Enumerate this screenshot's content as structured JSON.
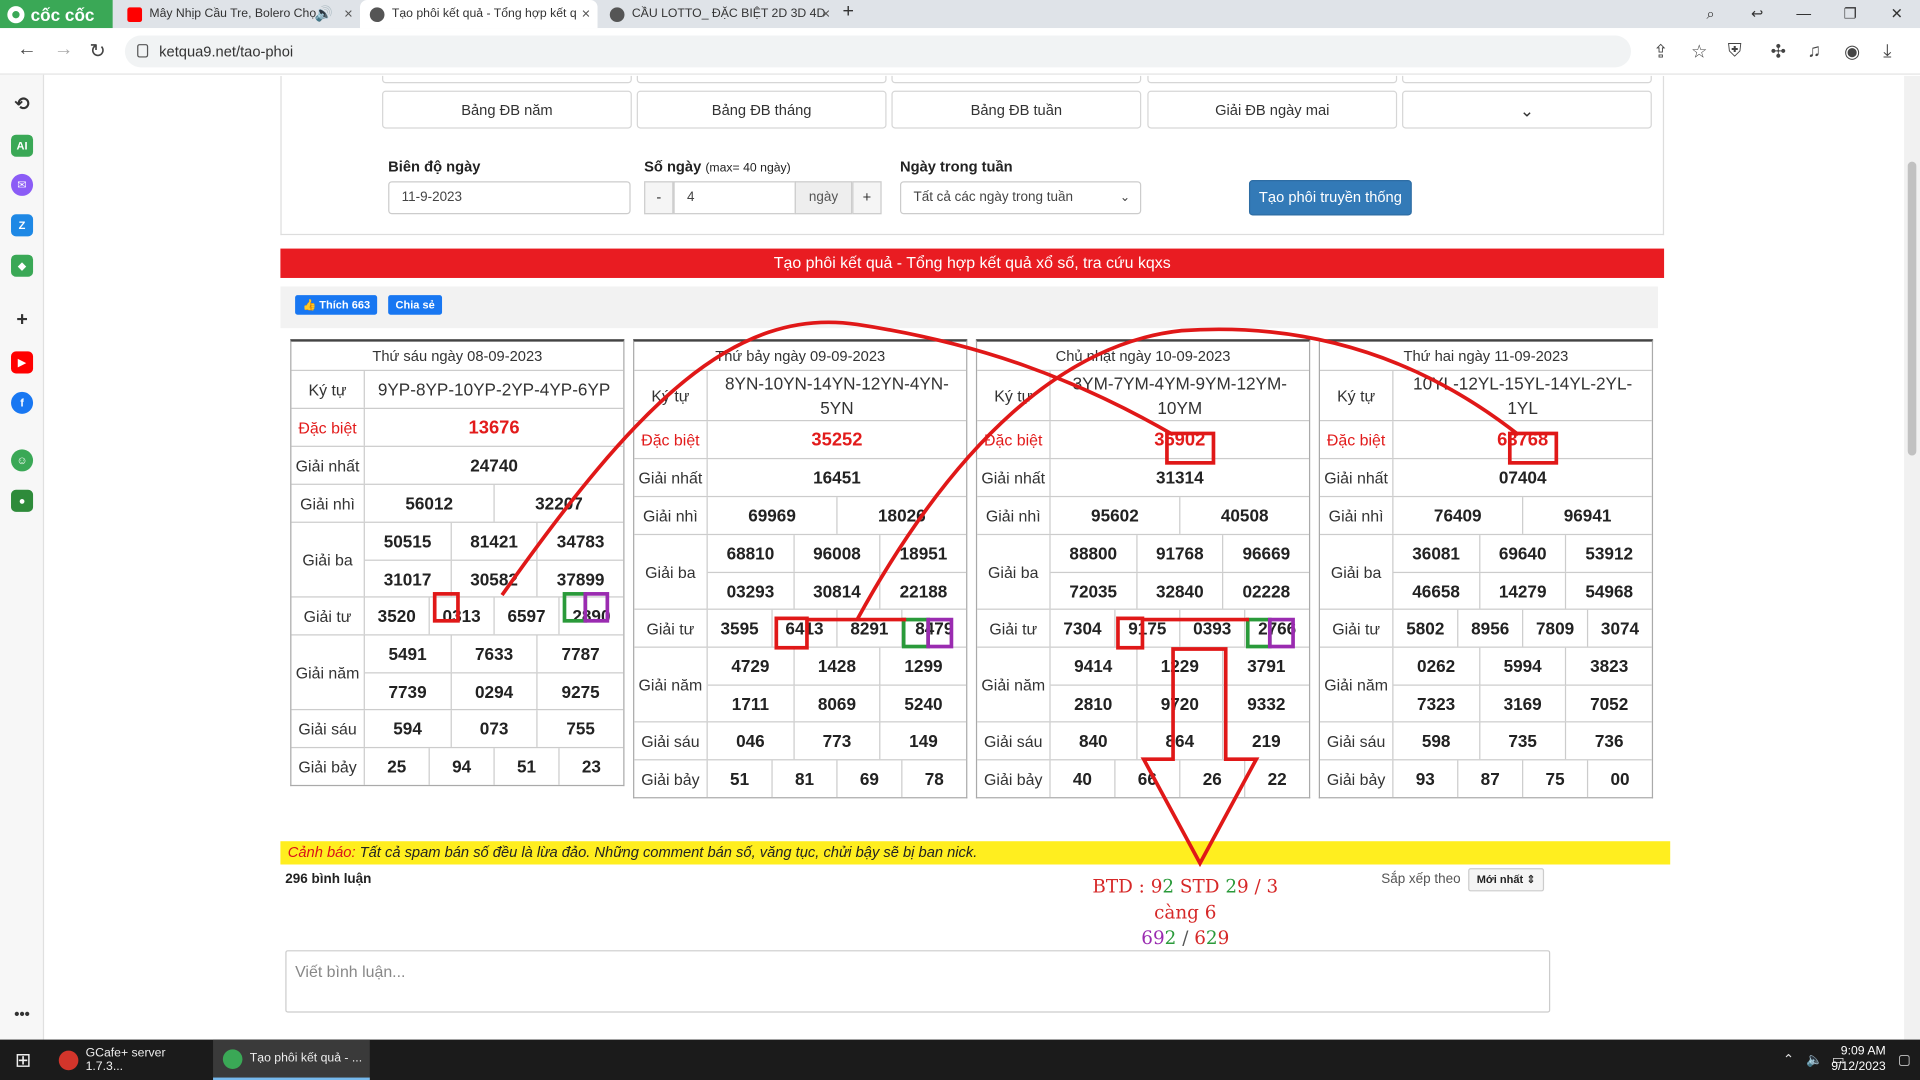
{
  "browser": {
    "brand": "cốc cốc",
    "tabs": [
      {
        "title": "Mây Nhịp Cầu Tre, Bolero Chọ"
      },
      {
        "title": "Tạo phôi kết quả - Tổng hợp kết q"
      },
      {
        "title": "CẦU LOTTO_ ĐẶC BIỆT 2D 3D 4D"
      }
    ],
    "url": "ketqua9.net/tao-phoi"
  },
  "quick_buttons": [
    "Bảng ĐB năm",
    "Bảng ĐB tháng",
    "Bảng ĐB tuần",
    "Giải ĐB ngày mai"
  ],
  "form": {
    "range_label": "Biên độ ngày",
    "range_value": "11-9-2023",
    "days_label": "Số ngày",
    "days_hint": "(max= 40 ngày)",
    "minus": "-",
    "days_value": "4",
    "days_unit": "ngày",
    "plus": "+",
    "weekday_label": "Ngày trong tuần",
    "weekday_value": "Tất cả các ngày trong tuần",
    "generate_button": "Tạo phôi truyền thống"
  },
  "banner": "Tạo phôi kết quả - Tổng hợp kết quả xổ số, tra cứu kqxs",
  "social": {
    "like": "Thích 663",
    "share": "Chia sẻ"
  },
  "labels": {
    "kytu": "Ký tự",
    "db": "Đặc biệt",
    "nhat": "Giải nhất",
    "nhi": "Giải nhì",
    "ba": "Giải ba",
    "tu": "Giải tư",
    "nam": "Giải năm",
    "sau": "Giải sáu",
    "bay": "Giải bảy"
  },
  "results": [
    {
      "date": "Thứ sáu ngày 08-09-2023",
      "code": "9YP-8YP-10YP-2YP-4YP-6YP",
      "db": "13676",
      "nhat": "24740",
      "nhi": [
        "56012",
        "32207"
      ],
      "ba": [
        "50515",
        "81421",
        "34783",
        "31017",
        "30582",
        "37899"
      ],
      "tu": [
        "3520",
        "0313",
        "6597",
        "2890"
      ],
      "nam": [
        "5491",
        "7633",
        "7787",
        "7739",
        "0294",
        "9275"
      ],
      "sau": [
        "594",
        "073",
        "755"
      ],
      "bay": [
        "25",
        "94",
        "51",
        "23"
      ]
    },
    {
      "date": "Thứ bảy ngày 09-09-2023",
      "code": "8YN-10YN-14YN-12YN-4YN-5YN",
      "db": "35252",
      "nhat": "16451",
      "nhi": [
        "69969",
        "18026"
      ],
      "ba": [
        "68810",
        "96008",
        "18951",
        "03293",
        "30814",
        "22188"
      ],
      "tu": [
        "3595",
        "6413",
        "8291",
        "8479"
      ],
      "nam": [
        "4729",
        "1428",
        "1299",
        "1711",
        "8069",
        "5240"
      ],
      "sau": [
        "046",
        "773",
        "149"
      ],
      "bay": [
        "51",
        "81",
        "69",
        "78"
      ]
    },
    {
      "date": "Chủ nhật ngày 10-09-2023",
      "code": "3YM-7YM-4YM-9YM-12YM-10YM",
      "db": "35902",
      "nhat": "31314",
      "nhi": [
        "95602",
        "40508"
      ],
      "ba": [
        "88800",
        "91768",
        "96669",
        "72035",
        "32840",
        "02228"
      ],
      "tu": [
        "7304",
        "9175",
        "0393",
        "2766"
      ],
      "nam": [
        "9414",
        "1229",
        "3791",
        "2810",
        "9720",
        "9332"
      ],
      "sau": [
        "840",
        "864",
        "219"
      ],
      "bay": [
        "40",
        "66",
        "26",
        "22"
      ]
    },
    {
      "date": "Thứ hai ngày 11-09-2023",
      "code": "10YL-12YL-15YL-14YL-2YL-1YL",
      "db": "63768",
      "nhat": "07404",
      "nhi": [
        "76409",
        "96941"
      ],
      "ba": [
        "36081",
        "69640",
        "53912",
        "46658",
        "14279",
        "54968"
      ],
      "tu": [
        "5802",
        "8956",
        "7809",
        "3074"
      ],
      "nam": [
        "0262",
        "5994",
        "3823",
        "7323",
        "3169",
        "7052"
      ],
      "sau": [
        "598",
        "735",
        "736"
      ],
      "bay": [
        "93",
        "87",
        "75",
        "00"
      ]
    }
  ],
  "annotation": {
    "l1_a": "BTD : ",
    "l1_b": "9",
    "l1_c": "2",
    "l1_d": " STD ",
    "l1_e": "2",
    "l1_f": "9",
    "l1_g": " / 3 càng ",
    "l1_h": "6",
    "l2_a": "69",
    "l2_b": "2",
    "l2_c": " / ",
    "l2_d": "6",
    "l2_e": "2",
    "l2_f": "9"
  },
  "warning": {
    "prefix": "Cảnh báo:",
    "text": " Tất cả spam bán số đều là lừa đảo. Những comment bán số, văng tục, chửi bậy sẽ bị ban nick."
  },
  "comments": {
    "count": "296 bình luận",
    "sort_label": "Sắp xếp theo",
    "sort_value": "Mới nhất ⇕",
    "placeholder": "Viết bình luận..."
  },
  "taskbar": {
    "item1": "GCafe+ server 1.7.3...",
    "item2": "Tạo phôi kết quả - ...",
    "time": "9:09 AM",
    "date": "9/12/2023"
  }
}
